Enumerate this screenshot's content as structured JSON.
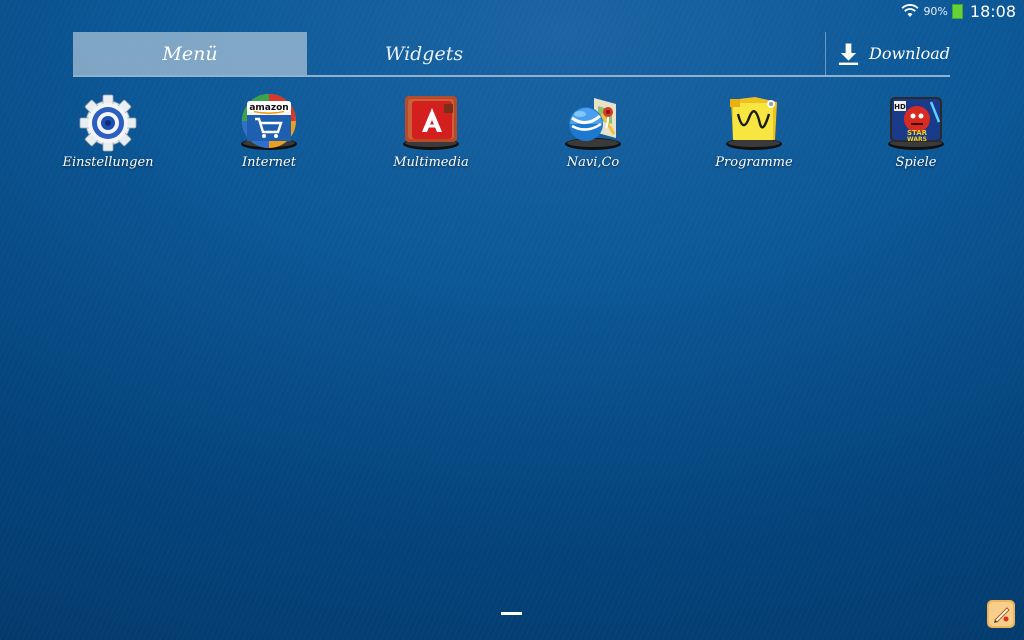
{
  "status_bar": {
    "battery_percent": "90%",
    "time": "18:08",
    "wifi_icon": "wifi-icon",
    "battery_icon": "battery-icon"
  },
  "tabs": [
    {
      "label": "Menü",
      "selected": true
    },
    {
      "label": "Widgets",
      "selected": false
    }
  ],
  "download": {
    "label": "Download",
    "icon": "download-icon"
  },
  "apps": [
    {
      "label": "Einstellungen",
      "icon": "settings-gear-icon"
    },
    {
      "label": "Internet",
      "icon": "amazon-folder-icon"
    },
    {
      "label": "Multimedia",
      "icon": "multimedia-folder-icon"
    },
    {
      "label": "Navi,Co",
      "icon": "maps-folder-icon"
    },
    {
      "label": "Programme",
      "icon": "programme-folder-icon"
    },
    {
      "label": "Spiele",
      "icon": "games-folder-icon"
    }
  ],
  "colors": {
    "background": "#0c5897",
    "selected_tab": "#a0bcd2",
    "tab_underline": "#8fb1cf",
    "battery": "#66d23a"
  }
}
